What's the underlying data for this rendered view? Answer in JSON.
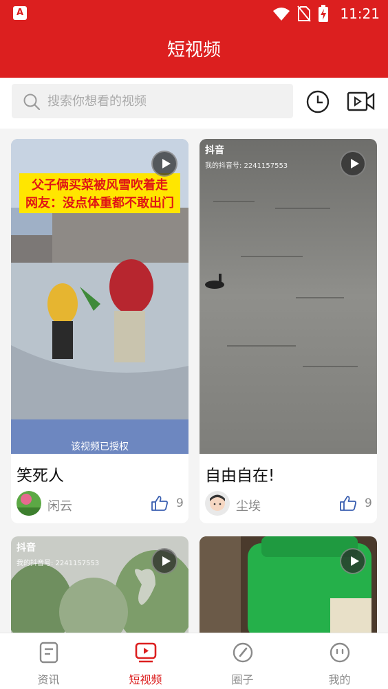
{
  "status_bar": {
    "time": "11:21",
    "app_icon_letter": "A"
  },
  "header": {
    "title": "短视频"
  },
  "search": {
    "placeholder": "搜索你想看的视频"
  },
  "cards": [
    {
      "title": "笑死人",
      "author": "闲云",
      "likes": "9",
      "overlay_line1": "父子俩买菜被风雪吹着走",
      "overlay_line2": "网友：没点体重都不敢出门",
      "auth_notice": "该视频已授权"
    },
    {
      "title": "自由自在!",
      "author": "尘埃",
      "likes": "9",
      "watermark_brand": "抖音",
      "watermark_id": "我的抖音号: 2241157553"
    },
    {
      "watermark_brand": "抖音",
      "watermark_id": "我的抖音号: 2241157553"
    },
    {}
  ],
  "tabs": [
    {
      "label": "资讯",
      "active": false
    },
    {
      "label": "短视频",
      "active": true
    },
    {
      "label": "圈子",
      "active": false
    },
    {
      "label": "我的",
      "active": false
    }
  ],
  "colors": {
    "brand_red": "#dc1f1f",
    "inactive_gray": "#8a8a8a"
  }
}
